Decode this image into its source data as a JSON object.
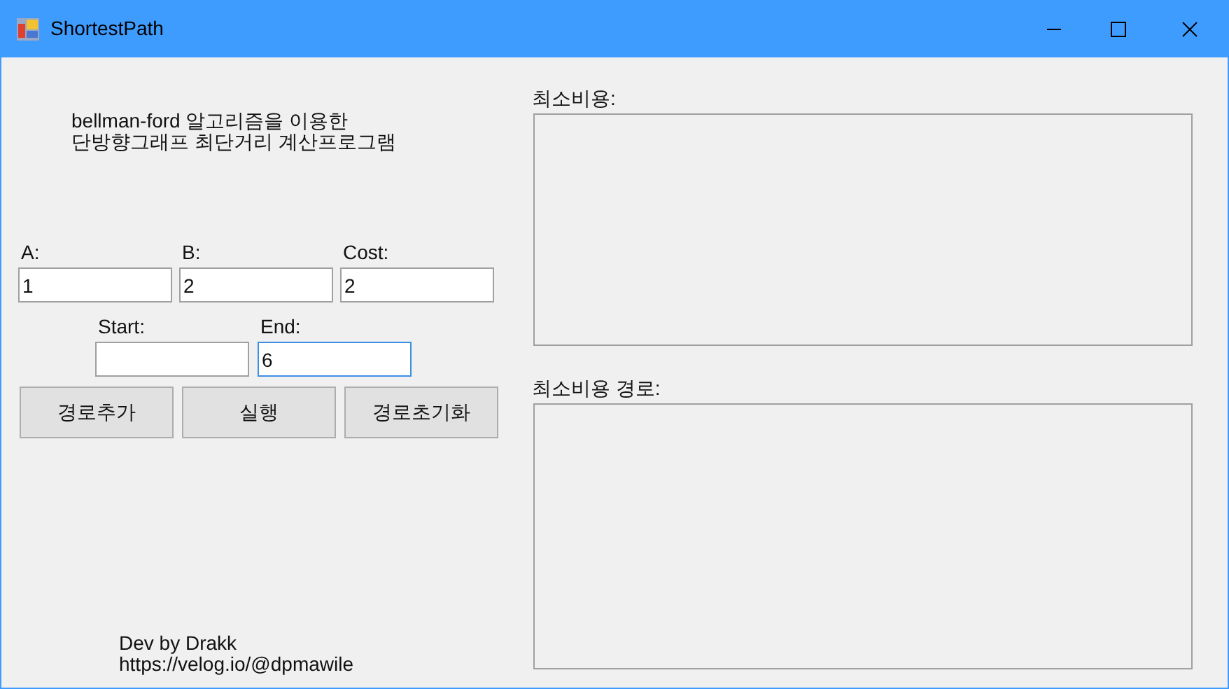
{
  "window": {
    "title": "ShortestPath"
  },
  "description": {
    "lines": [
      "bellman-ford 알고리즘을 이용한",
      "단방향그래프 최단거리 계산프로그램"
    ]
  },
  "edge_fields": [
    {
      "label": "A:",
      "value": "1",
      "focused": false
    },
    {
      "label": "B:",
      "value": "2",
      "focused": false
    },
    {
      "label": "Cost:",
      "value": "2",
      "focused": false
    }
  ],
  "route_fields": [
    {
      "label": "Start:",
      "focused": false
    },
    {
      "label": "End:",
      "value": "6",
      "focused": true
    }
  ],
  "buttons": [
    "경로추가",
    "실행",
    "경로초기화"
  ],
  "footer": {
    "lines": [
      "Dev by Drakk",
      "https://velog.io/@dpmawile"
    ]
  },
  "results": [
    {
      "label": "최소비용:"
    },
    {
      "label": "최소비용 경로:"
    }
  ]
}
